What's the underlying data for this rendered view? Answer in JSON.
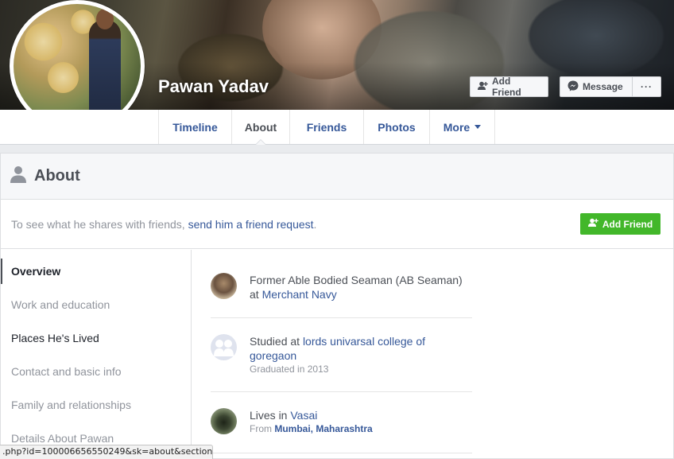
{
  "profile": {
    "name": "Pawan Yadav"
  },
  "cover_actions": {
    "add_friend": "Add Friend",
    "message": "Message",
    "more": "···"
  },
  "tabs": [
    {
      "label": "Timeline"
    },
    {
      "label": "About",
      "active": true
    },
    {
      "label": "Friends"
    },
    {
      "label": "Photos"
    },
    {
      "label": "More"
    }
  ],
  "about": {
    "title": "About",
    "notice_prefix": "To see what he shares with friends, ",
    "notice_link": "send him a friend request",
    "notice_suffix": ".",
    "add_friend_button": "Add Friend"
  },
  "sidebar": {
    "items": [
      {
        "label": "Overview"
      },
      {
        "label": "Work and education"
      },
      {
        "label": "Places He's Lived"
      },
      {
        "label": "Contact and basic info"
      },
      {
        "label": "Family and relationships"
      },
      {
        "label": "Details About Pawan"
      }
    ]
  },
  "entries": {
    "work": {
      "line1": "Former Able Bodied Seaman (AB Seaman)",
      "at": "at ",
      "employer": "Merchant Navy"
    },
    "education": {
      "prefix": "Studied at ",
      "school": "lords univarsal college of goregaon",
      "sub": "Graduated in 2013"
    },
    "lives": {
      "prefix": "Lives in ",
      "city": "Vasai",
      "from_label": "From ",
      "from_place": "Mumbai, Maharashtra"
    }
  },
  "statusbar": {
    "url": ".php?id=100006656550249&sk=about&section..."
  }
}
